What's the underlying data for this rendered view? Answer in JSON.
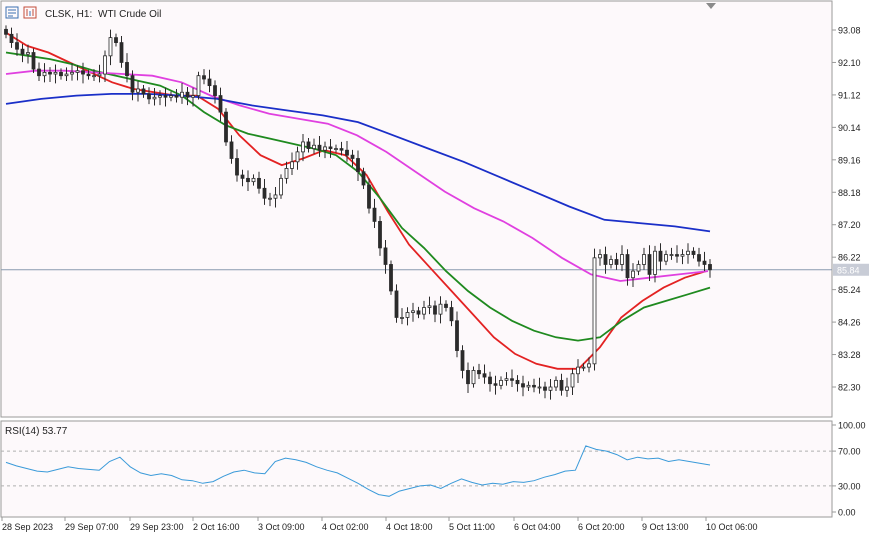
{
  "header": {
    "symbol_label": "CLSK, H1:",
    "instrument_label": "WTI Crude Oil"
  },
  "colors": {
    "background": "#fdf9fb",
    "frame": "#9a9a9a",
    "text": "#222222",
    "bull_candle": "#2b2b2b",
    "bear_candle": "#2b2b2b",
    "ma_red": "#e32222",
    "ma_green": "#1f8a1f",
    "ma_magenta": "#e040e0",
    "ma_blue": "#1a2fc8",
    "rsi_line": "#3a9ad9",
    "current_price_line": "#8a9ab0",
    "current_price_tag": "#c8ccd6"
  },
  "icons": [
    "chart-window-icon",
    "chart-properties-icon",
    "scroll-marker-icon"
  ],
  "main_panel": {
    "y_ticks": [
      "93.08",
      "92.10",
      "91.12",
      "90.14",
      "89.16",
      "88.18",
      "87.20",
      "86.22",
      "85.24",
      "84.26",
      "83.28",
      "82.30"
    ],
    "current_price": "85.84",
    "current_price_value": 85.84
  },
  "rsi_panel": {
    "label": "RSI(14) 53.77",
    "y_ticks": [
      "100.00",
      "70.00",
      "30.00",
      "0.00"
    ],
    "levels": [
      70,
      30
    ]
  },
  "x_axis": {
    "labels": [
      "28 Sep 2023",
      "29 Sep 07:00",
      "29 Sep 23:00",
      "2 Oct 16:00",
      "3 Oct 09:00",
      "4 Oct 02:00",
      "4 Oct 18:00",
      "5 Oct 11:00",
      "6 Oct 04:00",
      "6 Oct 20:00",
      "9 Oct 13:00",
      "10 Oct 06:00"
    ]
  },
  "chart_data": [
    {
      "type": "candlestick",
      "panel": "price",
      "ylim": [
        81.6,
        93.5
      ],
      "x": [
        0,
        106
      ],
      "candles_close": [
        92.95,
        92.7,
        92.5,
        92.35,
        92.4,
        91.9,
        91.7,
        91.8,
        91.75,
        91.8,
        91.7,
        91.75,
        91.8,
        91.85,
        91.75,
        91.7,
        91.7,
        91.75,
        92.3,
        92.85,
        92.7,
        92.1,
        91.7,
        91.2,
        91.3,
        91.15,
        91.0,
        91.05,
        91.1,
        91.05,
        91.1,
        91.05,
        91.2,
        91.05,
        91.1,
        91.7,
        91.6,
        91.4,
        91.1,
        90.6,
        89.7,
        89.2,
        88.7,
        88.6,
        88.5,
        88.6,
        88.3,
        88.0,
        88.0,
        88.1,
        88.6,
        88.9,
        89.1,
        89.4,
        89.7,
        89.5,
        89.6,
        89.45,
        89.55,
        89.5,
        89.5,
        89.45,
        89.3,
        89.2,
        88.8,
        88.4,
        87.7,
        87.3,
        86.5,
        86.0,
        85.2,
        84.4,
        84.4,
        84.55,
        84.6,
        84.5,
        84.7,
        84.75,
        84.5,
        84.8,
        84.7,
        84.3,
        83.4,
        82.8,
        82.4,
        82.8,
        82.7,
        82.6,
        82.4,
        82.35,
        82.5,
        82.55,
        82.5,
        82.4,
        82.3,
        82.35,
        82.3,
        82.3,
        82.2,
        82.3,
        82.5,
        82.2,
        82.3,
        82.7,
        82.9,
        82.9,
        83.0,
        86.2,
        86.3,
        86.0,
        86.15,
        86.0,
        86.3,
        85.6,
        85.8,
        86.0,
        86.3,
        85.7,
        86.4,
        86.1,
        86.3,
        86.3,
        86.25,
        86.3,
        86.4,
        86.3,
        86.1,
        86.0,
        85.84
      ],
      "series": [
        {
          "name": "",
          "color": "ma_red",
          "values": [
            93.0,
            92.6,
            92.4,
            92.1,
            91.8,
            91.5,
            91.3,
            91.2,
            91.1,
            91.1,
            90.7,
            89.9,
            89.3,
            89.0,
            89.2,
            89.45,
            89.3,
            88.7,
            87.6,
            86.6,
            85.9,
            85.2,
            84.5,
            83.8,
            83.3,
            83.0,
            82.85,
            82.85,
            83.5,
            84.4,
            84.9,
            85.3,
            85.6,
            85.8
          ]
        },
        {
          "name": "",
          "color": "ma_green",
          "values": [
            92.4,
            92.3,
            92.2,
            92.05,
            91.85,
            91.7,
            91.55,
            91.4,
            91.1,
            90.6,
            90.2,
            89.95,
            89.8,
            89.65,
            89.5,
            89.3,
            88.8,
            88.0,
            87.1,
            86.5,
            85.8,
            85.2,
            84.7,
            84.3,
            84.0,
            83.8,
            83.7,
            83.8,
            84.3,
            84.7,
            84.9,
            85.1,
            85.3
          ]
        },
        {
          "name": "",
          "color": "ma_magenta",
          "values": [
            91.75,
            91.85,
            91.85,
            91.8,
            91.75,
            91.7,
            91.5,
            91.1,
            90.8,
            90.55,
            90.4,
            90.25,
            89.9,
            89.4,
            88.8,
            88.2,
            87.7,
            87.3,
            86.8,
            86.2,
            85.7,
            85.5,
            85.6,
            85.7,
            85.8
          ]
        },
        {
          "name": "",
          "color": "ma_blue",
          "values": [
            90.85,
            91.0,
            91.1,
            91.15,
            91.15,
            91.1,
            91.0,
            90.8,
            90.65,
            90.5,
            90.3,
            89.9,
            89.5,
            89.1,
            88.65,
            88.2,
            87.75,
            87.35,
            87.25,
            87.15,
            87.0
          ]
        }
      ]
    },
    {
      "type": "line",
      "panel": "rsi",
      "title": "RSI(14) 53.77",
      "ylim": [
        0,
        100
      ],
      "values": [
        57,
        53,
        50,
        47,
        46,
        49,
        52,
        50,
        49,
        48,
        58,
        63,
        52,
        45,
        42,
        44,
        42,
        37,
        36,
        33,
        35,
        41,
        46,
        48,
        45,
        44,
        58,
        62,
        60,
        57,
        52,
        48,
        45,
        39,
        33,
        26,
        20,
        18,
        24,
        27,
        30,
        31,
        27,
        33,
        38,
        34,
        31,
        33,
        32,
        35,
        34,
        36,
        40,
        43,
        47,
        48,
        76,
        72,
        70,
        66,
        60,
        63,
        61,
        62,
        58,
        60,
        58,
        56,
        54
      ]
    }
  ]
}
